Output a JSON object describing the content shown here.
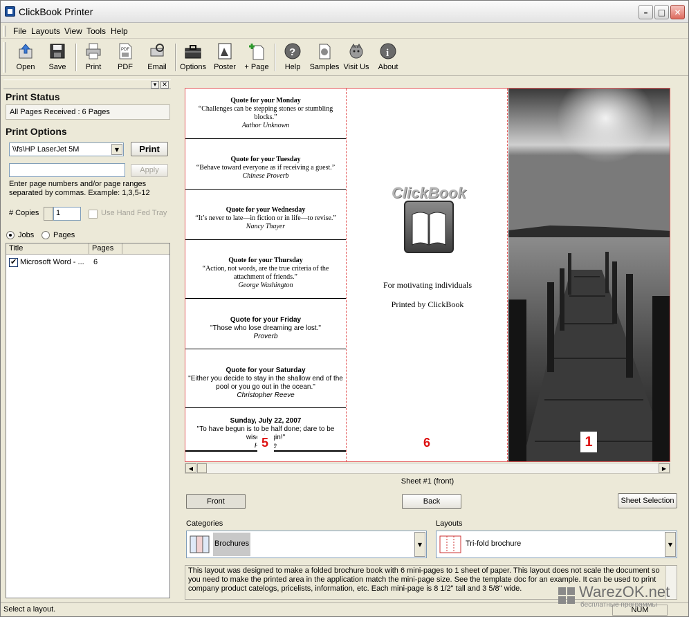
{
  "window": {
    "title": "ClickBook Printer"
  },
  "menu": [
    "File",
    "Layouts",
    "View",
    "Tools",
    "Help"
  ],
  "toolbar": {
    "buttons": [
      {
        "label": "Open",
        "icon": "open-icon"
      },
      {
        "label": "Save",
        "icon": "save-icon"
      },
      {
        "label": "Print",
        "icon": "printer-icon"
      },
      {
        "label": "PDF",
        "icon": "pdf-icon"
      },
      {
        "label": "Email",
        "icon": "email-icon"
      },
      {
        "label": "Options",
        "icon": "toolbox-icon"
      },
      {
        "label": "Poster",
        "icon": "poster-icon"
      },
      {
        "label": "+ Page",
        "icon": "add-page-icon"
      },
      {
        "label": "Help",
        "icon": "help-icon"
      },
      {
        "label": "Samples",
        "icon": "samples-icon"
      },
      {
        "label": "Visit Us",
        "icon": "globe-icon"
      },
      {
        "label": "About",
        "icon": "about-icon"
      }
    ]
  },
  "print_status": {
    "title": "Print Status",
    "value": "All Pages Received : 6 Pages"
  },
  "print_options": {
    "title": "Print Options",
    "printer": "\\\\fs\\HP LaserJet 5M",
    "print_button": "Print",
    "range_value": "",
    "apply_button": "Apply",
    "hint": "Enter page numbers and/or page ranges separated by commas.  Example:  1,3,5-12",
    "copies_label": "# Copies",
    "copies_value": "1",
    "hand_fed_label": "Use Hand Fed Tray",
    "hand_fed_checked": false
  },
  "view_mode": {
    "jobs_label": "Jobs",
    "pages_label": "Pages",
    "selected": "Jobs"
  },
  "job_list": {
    "columns": [
      "Title",
      "Pages"
    ],
    "rows": [
      {
        "title": "Microsoft Word - ...",
        "pages": "6",
        "checked": true
      }
    ]
  },
  "preview": {
    "quotes": [
      {
        "title": "Quote for your Monday",
        "text": "“Challenges can be stepping stones or stumbling blocks.”",
        "author": "Author Unknown"
      },
      {
        "title": "Quote for your Tuesday",
        "text": "“Behave toward everyone as if receiving a guest.”",
        "author": "Chinese Proverb"
      },
      {
        "title": "Quote for your Wednesday",
        "text": "“It’s never to late—in fiction or in life—to revise.”",
        "author": "Nancy Thayer"
      },
      {
        "title": "Quote for your Thursday",
        "text": "“Action, not words, are the true criteria of the attachment of friends.”",
        "author": "George Washington"
      },
      {
        "title": "Quote for your Friday",
        "text": "\"Those who lose dreaming are lost.\"",
        "author": "Proverb"
      },
      {
        "title": "Quote for your Saturday",
        "text": "\"Either you decide to stay in the shallow end of the pool or you go out in the ocean.\"",
        "author": "Christopher Reeve"
      },
      {
        "title": "Sunday, July 22, 2007",
        "text": "\"To have begun is to be half done; dare to be wise; begin!\"",
        "author": "Horace"
      }
    ],
    "logo_text": "ClickBook",
    "line1": "For motivating individuals",
    "line2": "Printed by ClickBook",
    "page_left": "5",
    "page_mid": "6",
    "page_right": "1"
  },
  "sheet_label": "Sheet #1 (front)",
  "buttons": {
    "front": "Front",
    "back": "Back",
    "sheet_selection": "Sheet Selection"
  },
  "categories": {
    "label": "Categories",
    "value": "Brochures"
  },
  "layouts": {
    "label": "Layouts",
    "value": "Tri-fold brochure"
  },
  "description": "This layout was designed to make a folded brochure book with 6 mini-pages to 1 sheet of paper.  This layout does not scale the document so you need to make the printed area in the application match the mini-page size.  See the template doc for an example.  It can be used to print company product catelogs, pricelists, information, etc.  Each mini-page is 8 1/2\" tall and 3 5/8\" wide.",
  "status_bar": {
    "text": "Select a layout.",
    "num": "NUM"
  },
  "watermark": {
    "text": "WarezOK.net",
    "sub": "бесплатные программы"
  },
  "colors": {
    "accent_red": "#d11111",
    "dashed_guide": "#e35a5a"
  }
}
